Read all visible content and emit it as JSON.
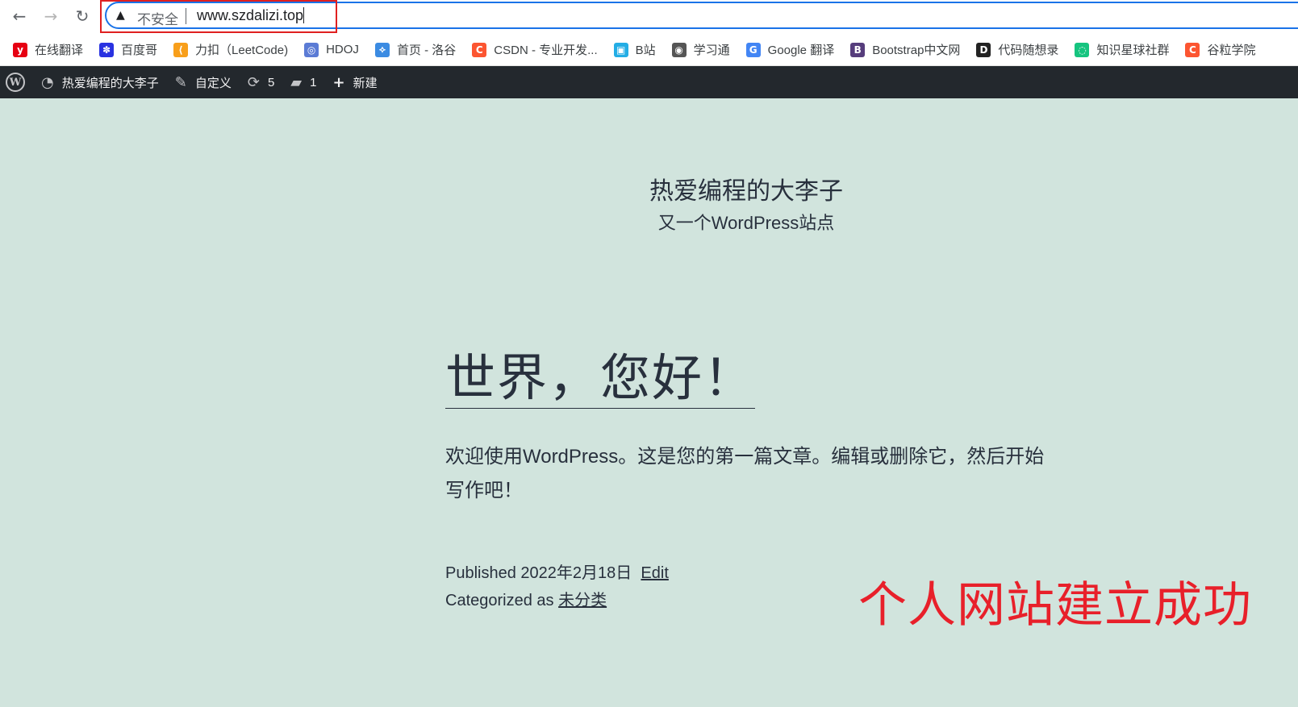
{
  "browser": {
    "back_icon": "←",
    "forward_icon": "→",
    "reload_icon": "↻",
    "security_warning": "不安全",
    "url": "www.szdalizi.top"
  },
  "bookmarks": [
    {
      "icon": "y",
      "color": "#e60012",
      "label": "在线翻译"
    },
    {
      "icon": "✽",
      "color": "#2932e1",
      "label": "百度哥"
    },
    {
      "icon": "⟨",
      "color": "#f89f1b",
      "label": "力扣（LeetCode)"
    },
    {
      "icon": "◎",
      "color": "#5b7bd5",
      "label": "HDOJ"
    },
    {
      "icon": "⟡",
      "color": "#3b8be2",
      "label": "首页 - 洛谷"
    },
    {
      "icon": "C",
      "color": "#fc5531",
      "label": "CSDN - 专业开发..."
    },
    {
      "icon": "▣",
      "color": "#23ade5",
      "label": "B站"
    },
    {
      "icon": "◉",
      "color": "#555555",
      "label": "学习通"
    },
    {
      "icon": "G",
      "color": "#4285f4",
      "label": "Google 翻译"
    },
    {
      "icon": "B",
      "color": "#563d7c",
      "label": "Bootstrap中文网"
    },
    {
      "icon": "D",
      "color": "#222222",
      "label": "代码随想录"
    },
    {
      "icon": "◌",
      "color": "#16c47f",
      "label": "知识星球社群"
    },
    {
      "icon": "C",
      "color": "#fc5531",
      "label": "谷粒学院"
    }
  ],
  "adminbar": {
    "site_name": "热爱编程的大李子",
    "customize": "自定义",
    "updates_count": "5",
    "comments_count": "1",
    "new_label": "新建"
  },
  "site": {
    "title": "热爱编程的大李子",
    "description": "又一个WordPress站点"
  },
  "post": {
    "title": "世界，您好！",
    "body": "欢迎使用WordPress。这是您的第一篇文章。编辑或删除它，然后开始写作吧！",
    "published_prefix": "Published",
    "published_date": "2022年2月18日",
    "edit_label": "Edit",
    "categorized_prefix": "Categorized as",
    "category": "未分类"
  },
  "annotation": "个人网站建立成功"
}
